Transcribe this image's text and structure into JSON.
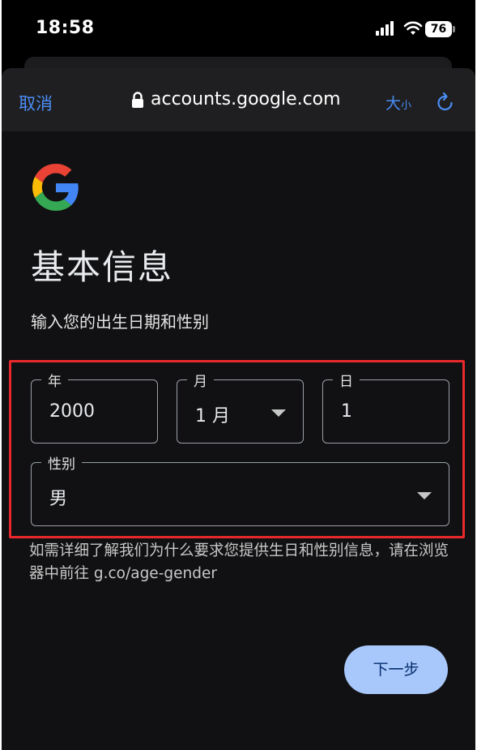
{
  "status_bar": {
    "time": "18:58",
    "battery": "76"
  },
  "browser": {
    "cancel_label": "取消",
    "url": "accounts.google.com",
    "size_label_big": "大",
    "size_label_small": "小"
  },
  "page": {
    "title": "基本信息",
    "subtitle": "输入您的出生日期和性别",
    "year": {
      "label": "年",
      "value": "2000"
    },
    "month": {
      "label": "月",
      "value": "1 月"
    },
    "day": {
      "label": "日",
      "value": "1"
    },
    "gender": {
      "label": "性别",
      "value": "男"
    },
    "help_text": "如需详细了解我们为什么要求您提供生日和性别信息，请在浏览器中前往 g.co/age-gender",
    "next_label": "下一步"
  },
  "colors": {
    "accent": "#4a8df5",
    "highlight": "#e8282b",
    "button_bg": "#a8c7fa",
    "background": "#111113"
  }
}
